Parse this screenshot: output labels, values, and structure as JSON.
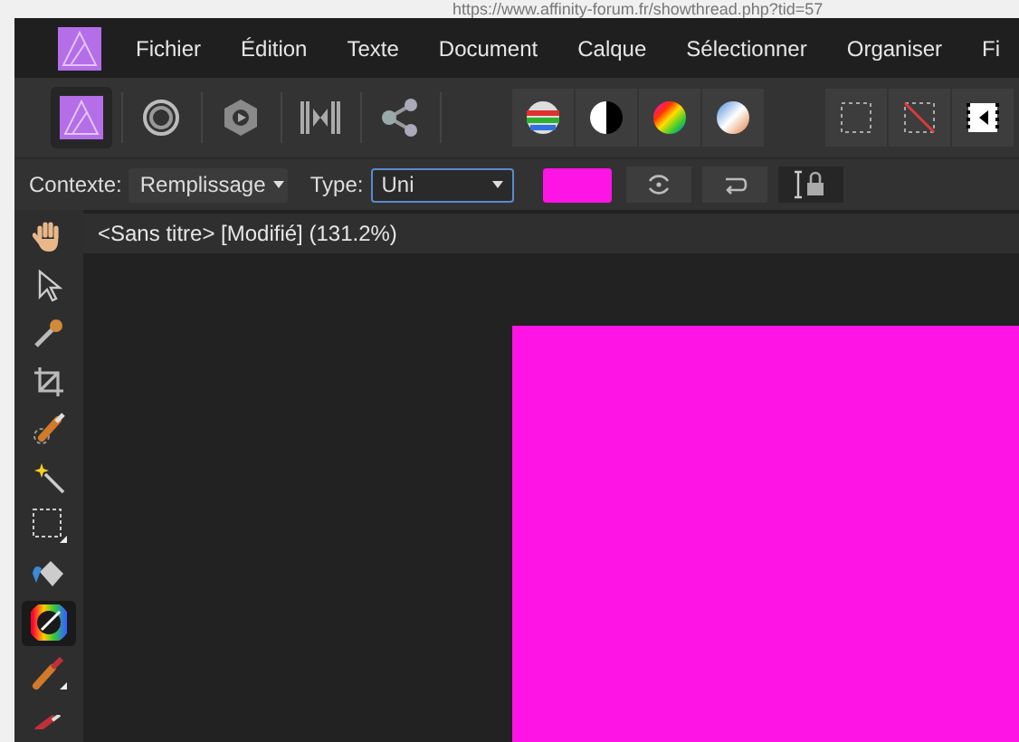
{
  "browser": {
    "address": "https://www.affinity-forum.fr/showthread.php?tid=57"
  },
  "menu": [
    "Fichier",
    "Édition",
    "Texte",
    "Document",
    "Calque",
    "Sélectionner",
    "Organiser",
    "Fi"
  ],
  "personas": [
    {
      "kind": "photo",
      "selected": true
    },
    {
      "kind": "liquify",
      "selected": false
    },
    {
      "kind": "develop",
      "selected": false
    },
    {
      "kind": "tonemap",
      "selected": false
    },
    {
      "kind": "export",
      "selected": false
    }
  ],
  "context_bar": {
    "context_label": "Contexte:",
    "context_value": "Remplissage",
    "type_label": "Type:",
    "type_value": "Uni",
    "fill": {
      "color": "#ff14e6"
    }
  },
  "document": {
    "title": "<Sans titre> [Modifié] (131.2%)"
  },
  "tools": [
    {
      "kind": "hand",
      "selected": false
    },
    {
      "kind": "pointer",
      "selected": false
    },
    {
      "kind": "pipette",
      "selected": false
    },
    {
      "kind": "crop",
      "selected": false
    },
    {
      "kind": "selection-brush",
      "selected": false
    },
    {
      "kind": "wand",
      "selected": false
    },
    {
      "kind": "marquee",
      "selected": false
    },
    {
      "kind": "bucket",
      "selected": false
    },
    {
      "kind": "gradient",
      "selected": true
    },
    {
      "kind": "paintbrush",
      "selected": false
    },
    {
      "kind": "paintbrush2",
      "selected": false
    }
  ]
}
